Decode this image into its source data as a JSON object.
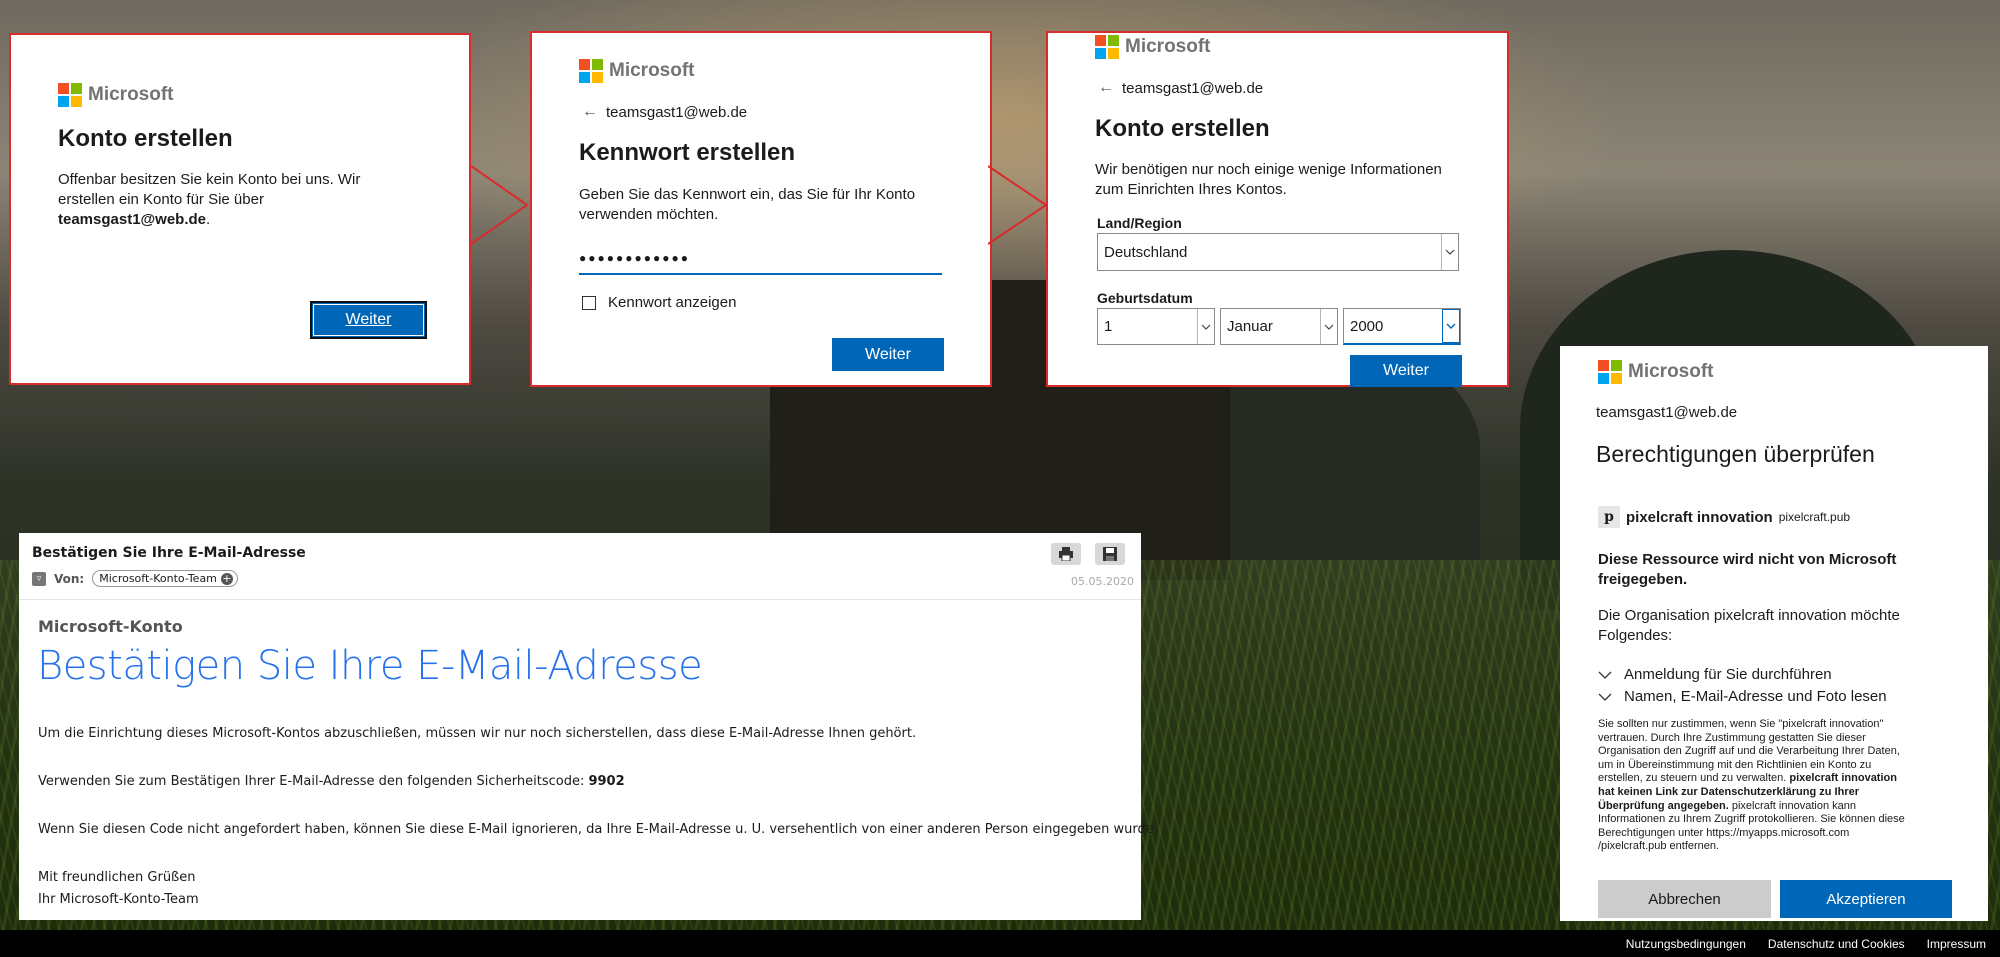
{
  "background": {
    "description_colors": {
      "sky": "#8c8576",
      "ground": "#1d2a12"
    }
  },
  "panel1": {
    "logo_text": "Microsoft",
    "title": "Konto erstellen",
    "body_line1": "Offenbar besitzen Sie kein Konto bei uns. Wir",
    "body_line2": "erstellen ein Konto für Sie über",
    "email": "teamsgast1@web.de",
    "email_suffix": ".",
    "button_label": "Weiter"
  },
  "panel2": {
    "logo_text": "Microsoft",
    "back_email": "teamsgast1@web.de",
    "title": "Kennwort erstellen",
    "body_line1": "Geben Sie das Kennwort ein, das Sie für Ihr Konto",
    "body_line2": "verwenden möchten.",
    "password_value": "●●●●●●●●●●●●",
    "show_password_label": "Kennwort anzeigen",
    "button_label": "Weiter"
  },
  "panel3": {
    "logo_text": "Microsoft",
    "back_email": "teamsgast1@web.de",
    "title": "Konto erstellen",
    "body_line1": "Wir benötigen nur noch einige wenige Informationen",
    "body_line2": "zum Einrichten Ihres Kontos.",
    "country_label": "Land/Region",
    "country_value": "Deutschland",
    "birthdate_label": "Geburtsdatum",
    "day_value": "1",
    "month_value": "Januar",
    "year_value": "2000",
    "button_label": "Weiter"
  },
  "email": {
    "subject": "Bestätigen Sie Ihre E-Mail-Adresse",
    "from_label": "Von:",
    "from_value": "Microsoft-Konto-Team",
    "date": "05.05.2020",
    "brand": "Microsoft-Konto",
    "heading": "Bestätigen Sie Ihre E-Mail-Adresse",
    "para1": "Um die Einrichtung dieses Microsoft-Kontos abzuschließen, müssen wir nur noch sicherstellen, dass diese E-Mail-Adresse Ihnen gehört.",
    "para2_prefix": "Verwenden Sie zum Bestätigen Ihrer E-Mail-Adresse den folgenden Sicherheitscode: ",
    "code": "9902",
    "para3": "Wenn Sie diesen Code nicht angefordert haben, können Sie diese E-Mail ignorieren, da Ihre E-Mail-Adresse u. U. versehentlich von einer anderen Person eingegeben wurde.",
    "greeting": "Mit freundlichen Grüßen",
    "signature": "Ihr Microsoft-Konto-Team"
  },
  "consent": {
    "logo_text": "Microsoft",
    "email": "teamsgast1@web.de",
    "title": "Berechtigungen überprüfen",
    "app_initial": "p",
    "app_name": "pixelcraft innovation",
    "app_domain": "pixelcraft.pub",
    "warning_line1": "Diese Ressource wird nicht von Microsoft",
    "warning_line2": "freigegeben.",
    "org_line1": "Die Organisation pixelcraft innovation möchte",
    "org_line2": "Folgendes:",
    "permissions": [
      "Anmeldung für Sie durchführen",
      "Namen, E-Mail-Adresse und Foto lesen"
    ],
    "fine_1": "Sie sollten nur zustimmen, wenn Sie \"pixelcraft innovation\"",
    "fine_2": "vertrauen. Durch Ihre Zustimmung gestatten Sie dieser",
    "fine_3": "Organisation den Zugriff auf und die Verarbeitung Ihrer Daten,",
    "fine_4": "um in Übereinstimmung mit den Richtlinien ein Konto zu",
    "fine_5a": "erstellen, zu steuern und zu verwalten. ",
    "fine_5b": "pixelcraft innovation",
    "fine_6": "hat keinen Link zur Datenschutzerklärung zu Ihrer",
    "fine_7a": "Überprüfung angegeben.",
    "fine_7b": " pixelcraft innovation kann",
    "fine_8": "Informationen zu Ihrem Zugriff protokollieren. Sie können diese",
    "fine_9": "Berechtigungen unter https://myapps.microsoft.com",
    "fine_10": "/pixelcraft.pub entfernen.",
    "cancel_label": "Abbrechen",
    "accept_label": "Akzeptieren"
  },
  "footer": {
    "links": [
      "Nutzungsbedingungen",
      "Datenschutz und Cookies",
      "Impressum"
    ]
  }
}
